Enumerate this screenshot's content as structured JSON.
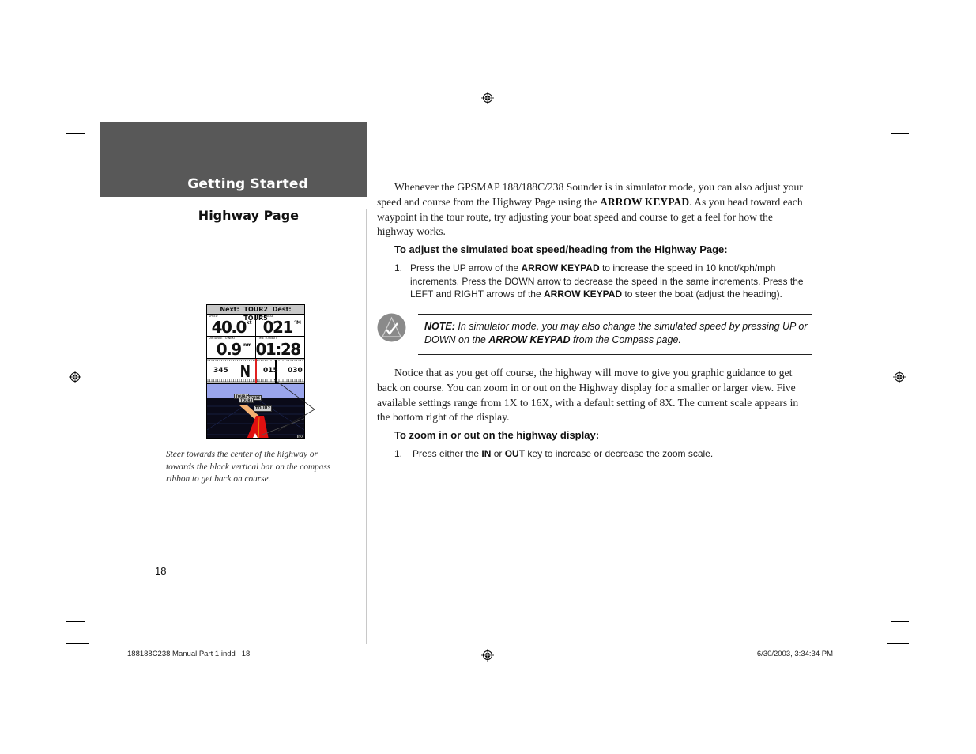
{
  "header": {
    "section_title": "Getting Started",
    "page_subtitle": "Highway Page",
    "band_color": "#585858"
  },
  "figure": {
    "gps_screen": {
      "top_bar": "Next: TOUR2   Dest: TOUR5",
      "fields": [
        {
          "label": "SPEED",
          "value": "40.0",
          "unit": "kt"
        },
        {
          "label": "TO COURSE",
          "value": "021",
          "unit": "°M"
        },
        {
          "label": "DISTANCE TO NEXT",
          "value": "0.9",
          "unit": "nm"
        },
        {
          "label": "TIME TO NEXT",
          "value": "01:28",
          "unit": ""
        }
      ],
      "compass_ribbon": {
        "labels": [
          "345",
          "N",
          "015",
          "030"
        ],
        "course_marker_color": "#e02020",
        "bearing_marker_color": "#000000"
      },
      "waypoints": [
        "TOUR4",
        "TOUR3",
        "TOUR5",
        "TOUR2"
      ],
      "zoom_scale": "8X",
      "highway_color": "#e01010",
      "sky_color": "#9aa5ec"
    },
    "caption": "Steer towards the center of the highway or towards the black vertical bar on the compass ribbon to get back on course."
  },
  "page_number": "18",
  "content": {
    "intro_paragraph": {
      "before": "Whenever the GPSMAP 188/188C/238 Sounder is in simulator mode, you can also adjust your speed and course from the Highway Page using the ",
      "bold": "ARROW KEYPAD",
      "after": ". As you head toward each waypoint in the tour route, try adjusting your boat speed and course to get a feel for how the highway works."
    },
    "procedure1": {
      "heading": "To adjust the simulated boat speed/heading from the Highway Page:",
      "steps": [
        {
          "num": "1.",
          "t1": "Press the UP arrow of the ",
          "b1": "ARROW KEYPAD",
          "t2": " to increase the speed in 10 knot/kph/mph increments. Press the DOWN arrow to decrease the speed in the same increments. Press the LEFT and RIGHT arrows of the ",
          "b2": "ARROW KEYPAD",
          "t3": " to steer the boat (adjust the heading)."
        }
      ]
    },
    "note": {
      "icon": "checkmark-note-icon",
      "label": "NOTE:",
      "t1": " In simulator mode, you may also change the simulated speed by pressing UP or DOWN on the ",
      "bold": "ARROW KEYPAD",
      "t2": " from the Compass page."
    },
    "notice_paragraph": "Notice that as you get off course, the highway will move to give you graphic guidance to get back on course. You can zoom in or out on the Highway display for a smaller or larger view. Five available settings range from 1X to 16X, with a default setting of 8X. The current scale appears in the bottom right of the display.",
    "procedure2": {
      "heading": "To zoom in or out on the highway display:",
      "steps": [
        {
          "num": "1.",
          "t1": "Press either the ",
          "b1": "IN",
          "t2": " or ",
          "b2": "OUT",
          "t3": " key to increase or decrease the zoom scale."
        }
      ]
    }
  },
  "print_slug": {
    "file": "188188C238 Manual Part 1.indd   18",
    "timestamp": "6/30/2003, 3:34:34 PM"
  }
}
